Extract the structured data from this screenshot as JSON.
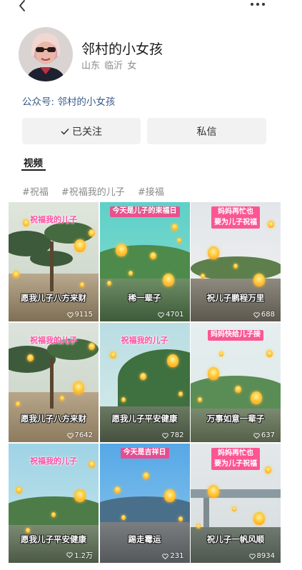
{
  "profile": {
    "name": "邻村的小女孩",
    "location": "山东 临沂 女",
    "official_account": "公众号: 邻村的小女孩"
  },
  "actions": {
    "follow_label": "已关注",
    "message_label": "私信"
  },
  "tabs": [
    {
      "label": "视频"
    }
  ],
  "tags": [
    "#祝福",
    "#祝福我的儿子",
    "#接福"
  ],
  "videos": [
    {
      "top": "祝福我的儿子",
      "bottom": "愿我儿子八方来财",
      "likes": "9115"
    },
    {
      "top": "今天是儿子的束福日",
      "bottom": "稀一辈子",
      "likes": "4701"
    },
    {
      "top": "妈妈再忙也\n要为儿子祝福",
      "bottom": "祝儿子鹏程万里",
      "likes": "688"
    },
    {
      "top": "祝福我的儿子",
      "bottom": "愿我儿子八方来财",
      "likes": "7642"
    },
    {
      "top": "祝福我的儿子",
      "bottom": "愿我儿子平安健康",
      "likes": "782"
    },
    {
      "top": "妈妈快给儿子接",
      "bottom": "万事如意一辈子",
      "likes": "637"
    },
    {
      "top": "祝福我的儿子",
      "bottom": "愿我儿子平安健康",
      "likes": "1.2万"
    },
    {
      "top": "今天是吉祥日",
      "bottom": "踢走霉运",
      "likes": "231"
    },
    {
      "top": "妈妈再忙也\n要为儿子祝福",
      "bottom": "祝儿子一帆风顺",
      "likes": "8934"
    }
  ],
  "colors": {
    "link": "#3a5a8c",
    "button_bg": "#f2f2f2",
    "caption_pink": "#ff4fa3"
  }
}
